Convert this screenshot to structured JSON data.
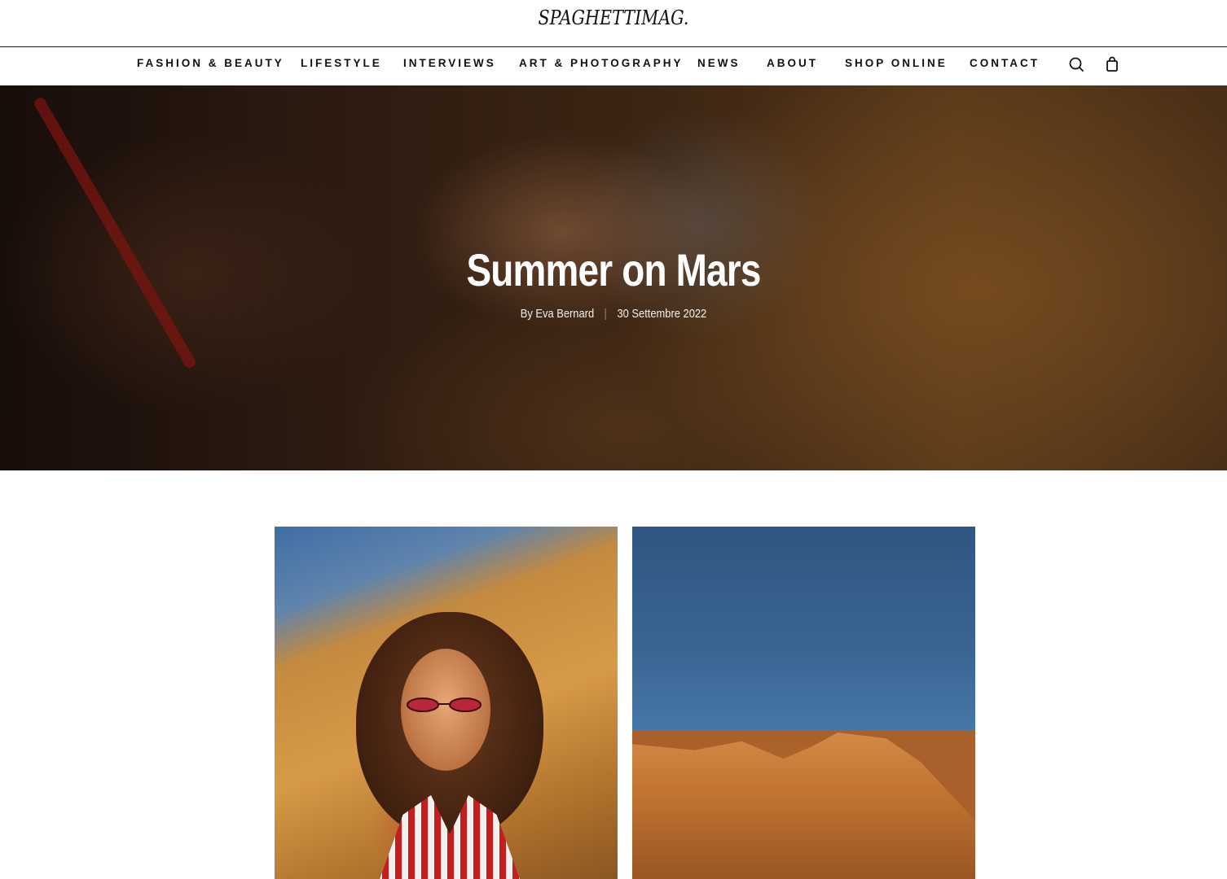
{
  "site": {
    "logo": "SPAGHETTIMAG."
  },
  "nav": {
    "items": [
      {
        "label": "FASHION & BEAUTY",
        "id": "fashion-beauty"
      },
      {
        "label": "LIFESTYLE",
        "id": "lifestyle"
      },
      {
        "label": "INTERVIEWS",
        "id": "interviews"
      },
      {
        "label": "ART & PHOTOGRAPHY",
        "id": "art-photography"
      },
      {
        "label": "NEWS",
        "id": "news"
      },
      {
        "label": "ABOUT",
        "id": "about"
      },
      {
        "label": "SHOP ONLINE",
        "id": "shop-online"
      },
      {
        "label": "CONTACT",
        "id": "contact"
      }
    ],
    "icons": [
      "search-icon",
      "shopping-bag-icon"
    ]
  },
  "article": {
    "title": "Summer on Mars",
    "author": "By Eva Bernard",
    "date": "30 Settembre 2022"
  },
  "colors": {
    "text": "#111111",
    "background": "#ffffff",
    "hero_overlay_text": "#ffffff"
  }
}
